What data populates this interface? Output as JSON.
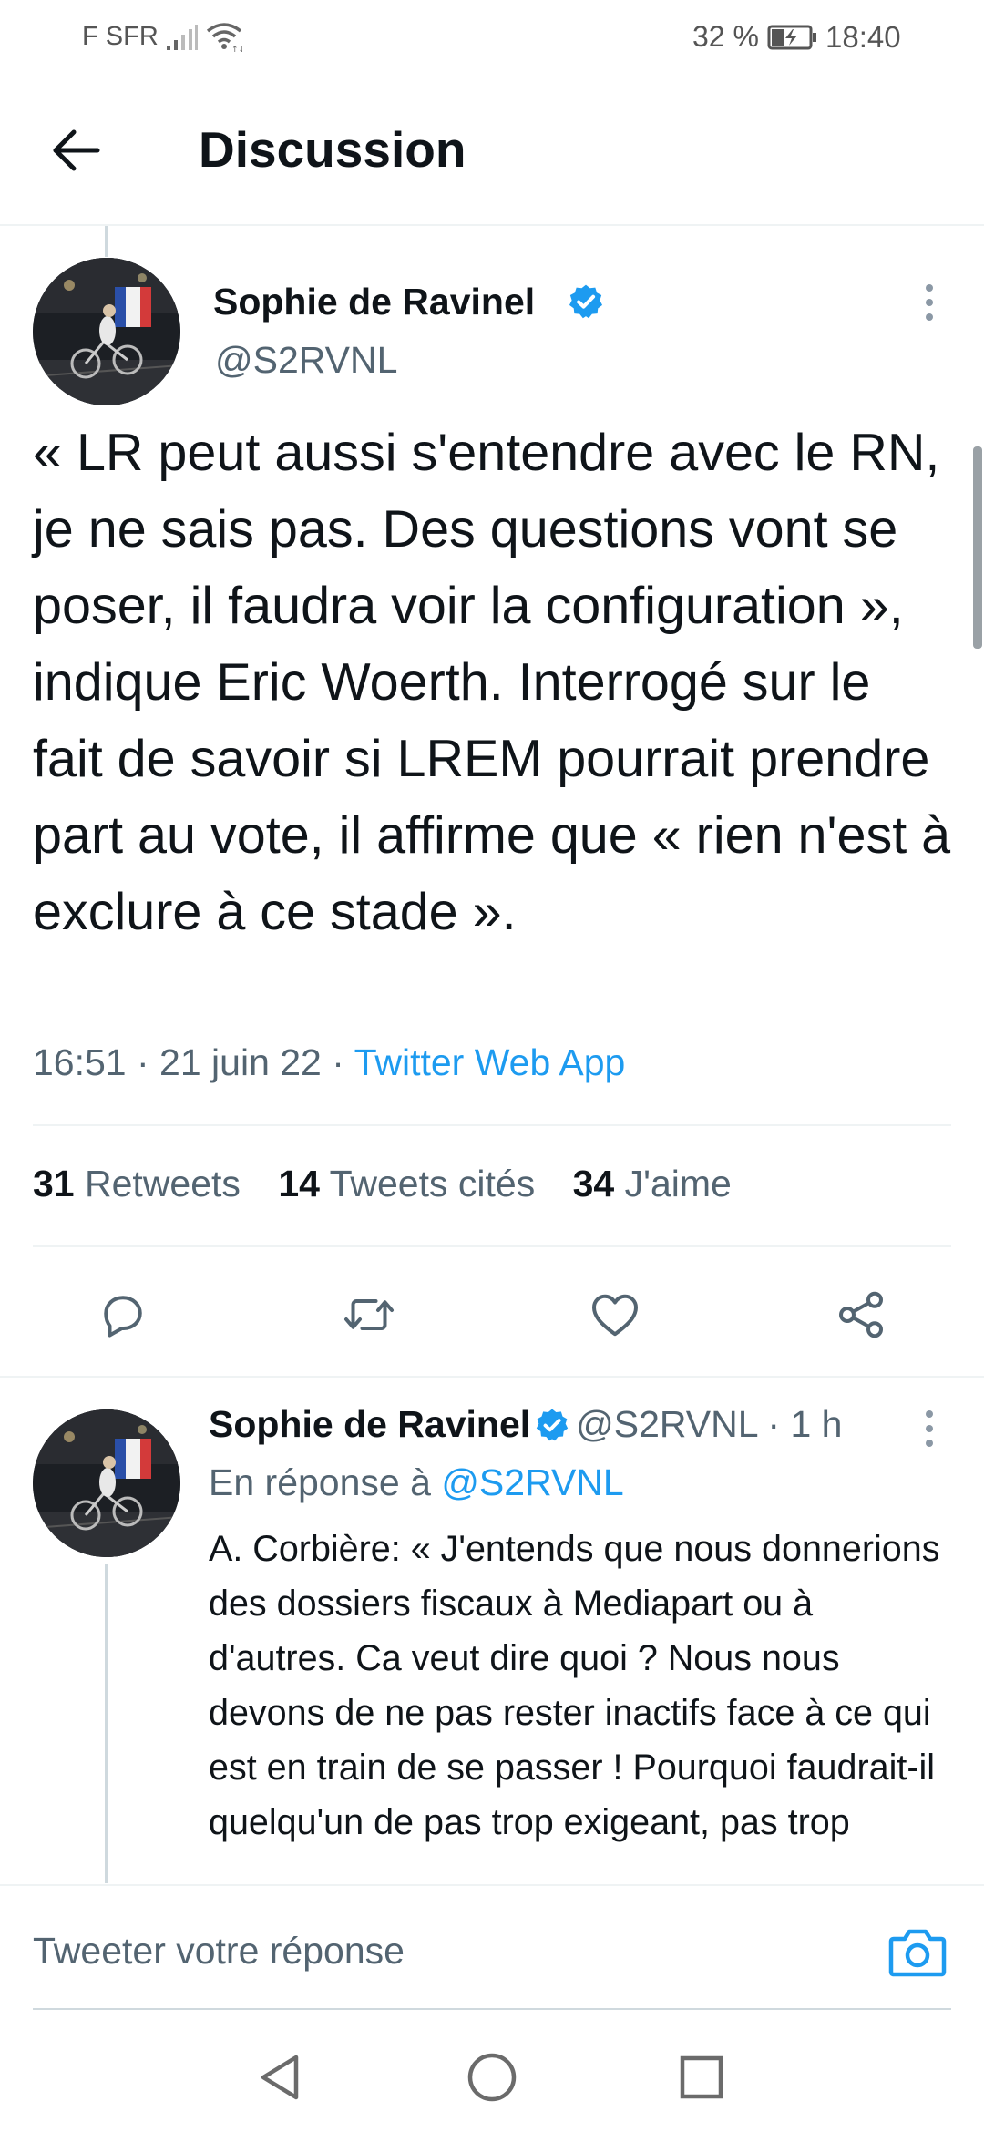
{
  "status_bar": {
    "carrier": "F SFR",
    "battery_percent": "32 %",
    "time": "18:40"
  },
  "header": {
    "title": "Discussion"
  },
  "main_tweet": {
    "author_name": "Sophie de Ravinel",
    "handle": "@S2RVNL",
    "text": "« LR peut aussi s'entendre avec le RN, je ne sais pas. Des questions vont se poser, il faudra voir la configuration », indique Eric Woerth. Interrogé sur le fait de savoir si LREM pourrait prendre part au vote, il affirme que « rien n'est à exclure à ce stade ».",
    "time": "16:51",
    "date": "21 juin 22",
    "source": "Twitter Web App",
    "stats": {
      "retweets_count": "31",
      "retweets_label": "Retweets",
      "quotes_count": "14",
      "quotes_label": "Tweets cités",
      "likes_count": "34",
      "likes_label": "J'aime"
    }
  },
  "reply": {
    "author_name": "Sophie de Ravinel",
    "handle": "@S2RVNL",
    "age": "1 h",
    "reply_to_label": "En réponse à",
    "reply_to_handle": "@S2RVNL",
    "text": "A. Corbière: « J'entends que nous donnerions des dossiers fiscaux à Mediapart ou à d'autres. Ca veut dire quoi ? Nous nous devons de ne pas rester inactifs face à ce qui est en train de se passer ! Pourquoi faudrait-il quelqu'un de pas trop exigeant, pas trop"
  },
  "composer": {
    "placeholder": "Tweeter votre réponse"
  },
  "colors": {
    "accent": "#1d9bf0",
    "text": "#0f1419",
    "muted": "#536471",
    "divider": "#eff3f4"
  },
  "icons": {
    "back": "arrow-left-icon",
    "verified": "verified-badge-icon",
    "more": "more-vertical-icon",
    "reply": "reply-icon",
    "retweet": "retweet-icon",
    "like": "heart-icon",
    "share": "share-icon",
    "camera": "camera-icon",
    "nav_back": "nav-back-icon",
    "nav_home": "nav-home-icon",
    "nav_recents": "nav-recents-icon"
  }
}
